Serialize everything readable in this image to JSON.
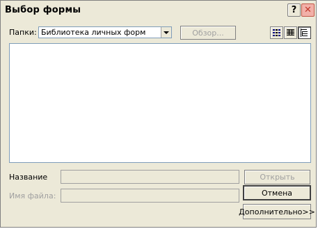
{
  "window": {
    "title": "Выбор формы",
    "help_glyph": "?",
    "close_glyph": "✕"
  },
  "folder": {
    "label": "Папки:",
    "selected": "Библиотека личных форм"
  },
  "browse_label": "Обзор...",
  "view_icons": [
    "list-view-icon",
    "details-view-icon",
    "tree-view-icon"
  ],
  "name_label": "Название",
  "filename_label": "Имя файла:",
  "name_value": "",
  "filename_value": "",
  "buttons": {
    "open": "Открыть",
    "cancel": "Отмена",
    "advanced": "Дополнительно>>"
  },
  "colors": {
    "window_bg": "#ece9d8",
    "list_bg": "#ffffff",
    "close_bg": "#f2b0a8",
    "disabled_text": "#a0a0a0"
  }
}
